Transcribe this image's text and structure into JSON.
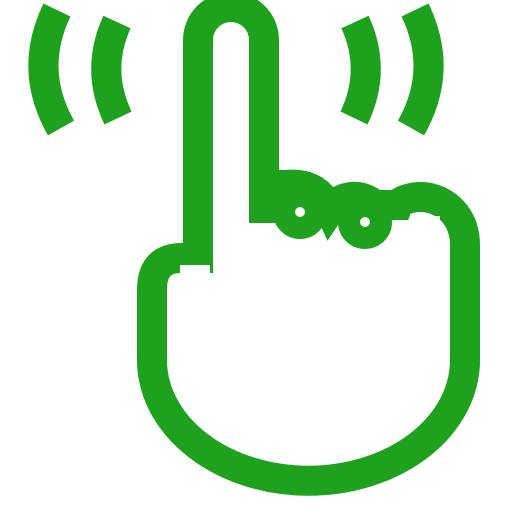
{
  "icon": {
    "name": "tap-gesture-icon",
    "color": "#1ea21e",
    "background": "#ffffff"
  }
}
